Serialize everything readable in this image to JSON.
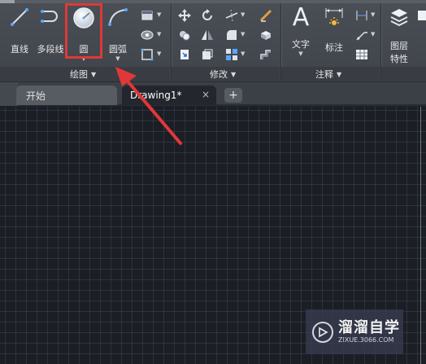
{
  "ribbon": {
    "draw": {
      "title": "绘图",
      "line_label": "直线",
      "polyline_label": "多段线",
      "circle_label": "圆",
      "arc_label": "圆弧"
    },
    "modify": {
      "title": "修改"
    },
    "annotation": {
      "title": "注释",
      "text_label": "文字",
      "dimension_label": "标注"
    },
    "layers": {
      "properties_line1": "图层",
      "properties_line2": "特性"
    }
  },
  "tabs": {
    "start_label": "开始",
    "drawing_label": "Drawing1*",
    "close_glyph": "×",
    "add_glyph": "+"
  },
  "watermark": {
    "main": "溜溜自学",
    "sub": "ZIXUE.3066.COM"
  },
  "colors": {
    "highlight_box": "#e03838",
    "arrow": "#e03838",
    "ribbon_bg": "#444850",
    "canvas_bg": "#1b1e24"
  },
  "icons": [
    "line-icon",
    "polyline-icon",
    "circle-icon",
    "arc-icon",
    "rectangle-icon",
    "hatch-icon",
    "gradient-icon",
    "move-icon",
    "rotate-icon",
    "trim-icon",
    "erase-icon",
    "copy-icon",
    "mirror-icon",
    "fillet-icon",
    "explode-icon",
    "stretch-icon",
    "scale-icon",
    "array-icon",
    "offset-icon",
    "text-icon",
    "dimension-icon",
    "layer-properties-icon"
  ]
}
